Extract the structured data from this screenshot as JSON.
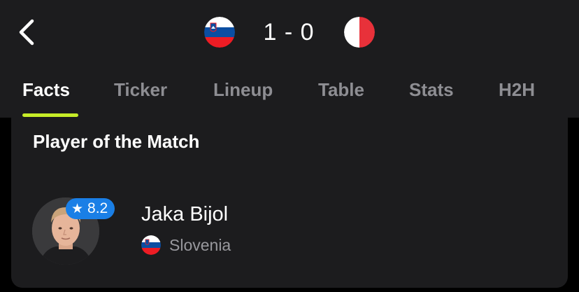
{
  "header": {
    "back_icon": "chevron-left-icon",
    "home_flag": "slovenia-flag-icon",
    "away_flag": "malta-flag-icon",
    "score": "1 - 0"
  },
  "tabs": [
    {
      "label": "Facts",
      "active": true
    },
    {
      "label": "Ticker",
      "active": false
    },
    {
      "label": "Lineup",
      "active": false
    },
    {
      "label": "Table",
      "active": false
    },
    {
      "label": "Stats",
      "active": false
    },
    {
      "label": "H2H",
      "active": false
    }
  ],
  "colors": {
    "background": "#000000",
    "surface": "#1c1c1e",
    "accent": "#c6ec28",
    "rating_badge": "#1a7fe6",
    "inactive_tab": "#8e8e93"
  },
  "player_of_match": {
    "title": "Player of the Match",
    "rating": "8.2",
    "rating_icon": "star-icon",
    "player_name": "Jaka Bijol",
    "country": "Slovenia",
    "country_flag": "slovenia-flag-icon",
    "avatar": "player-photo"
  }
}
